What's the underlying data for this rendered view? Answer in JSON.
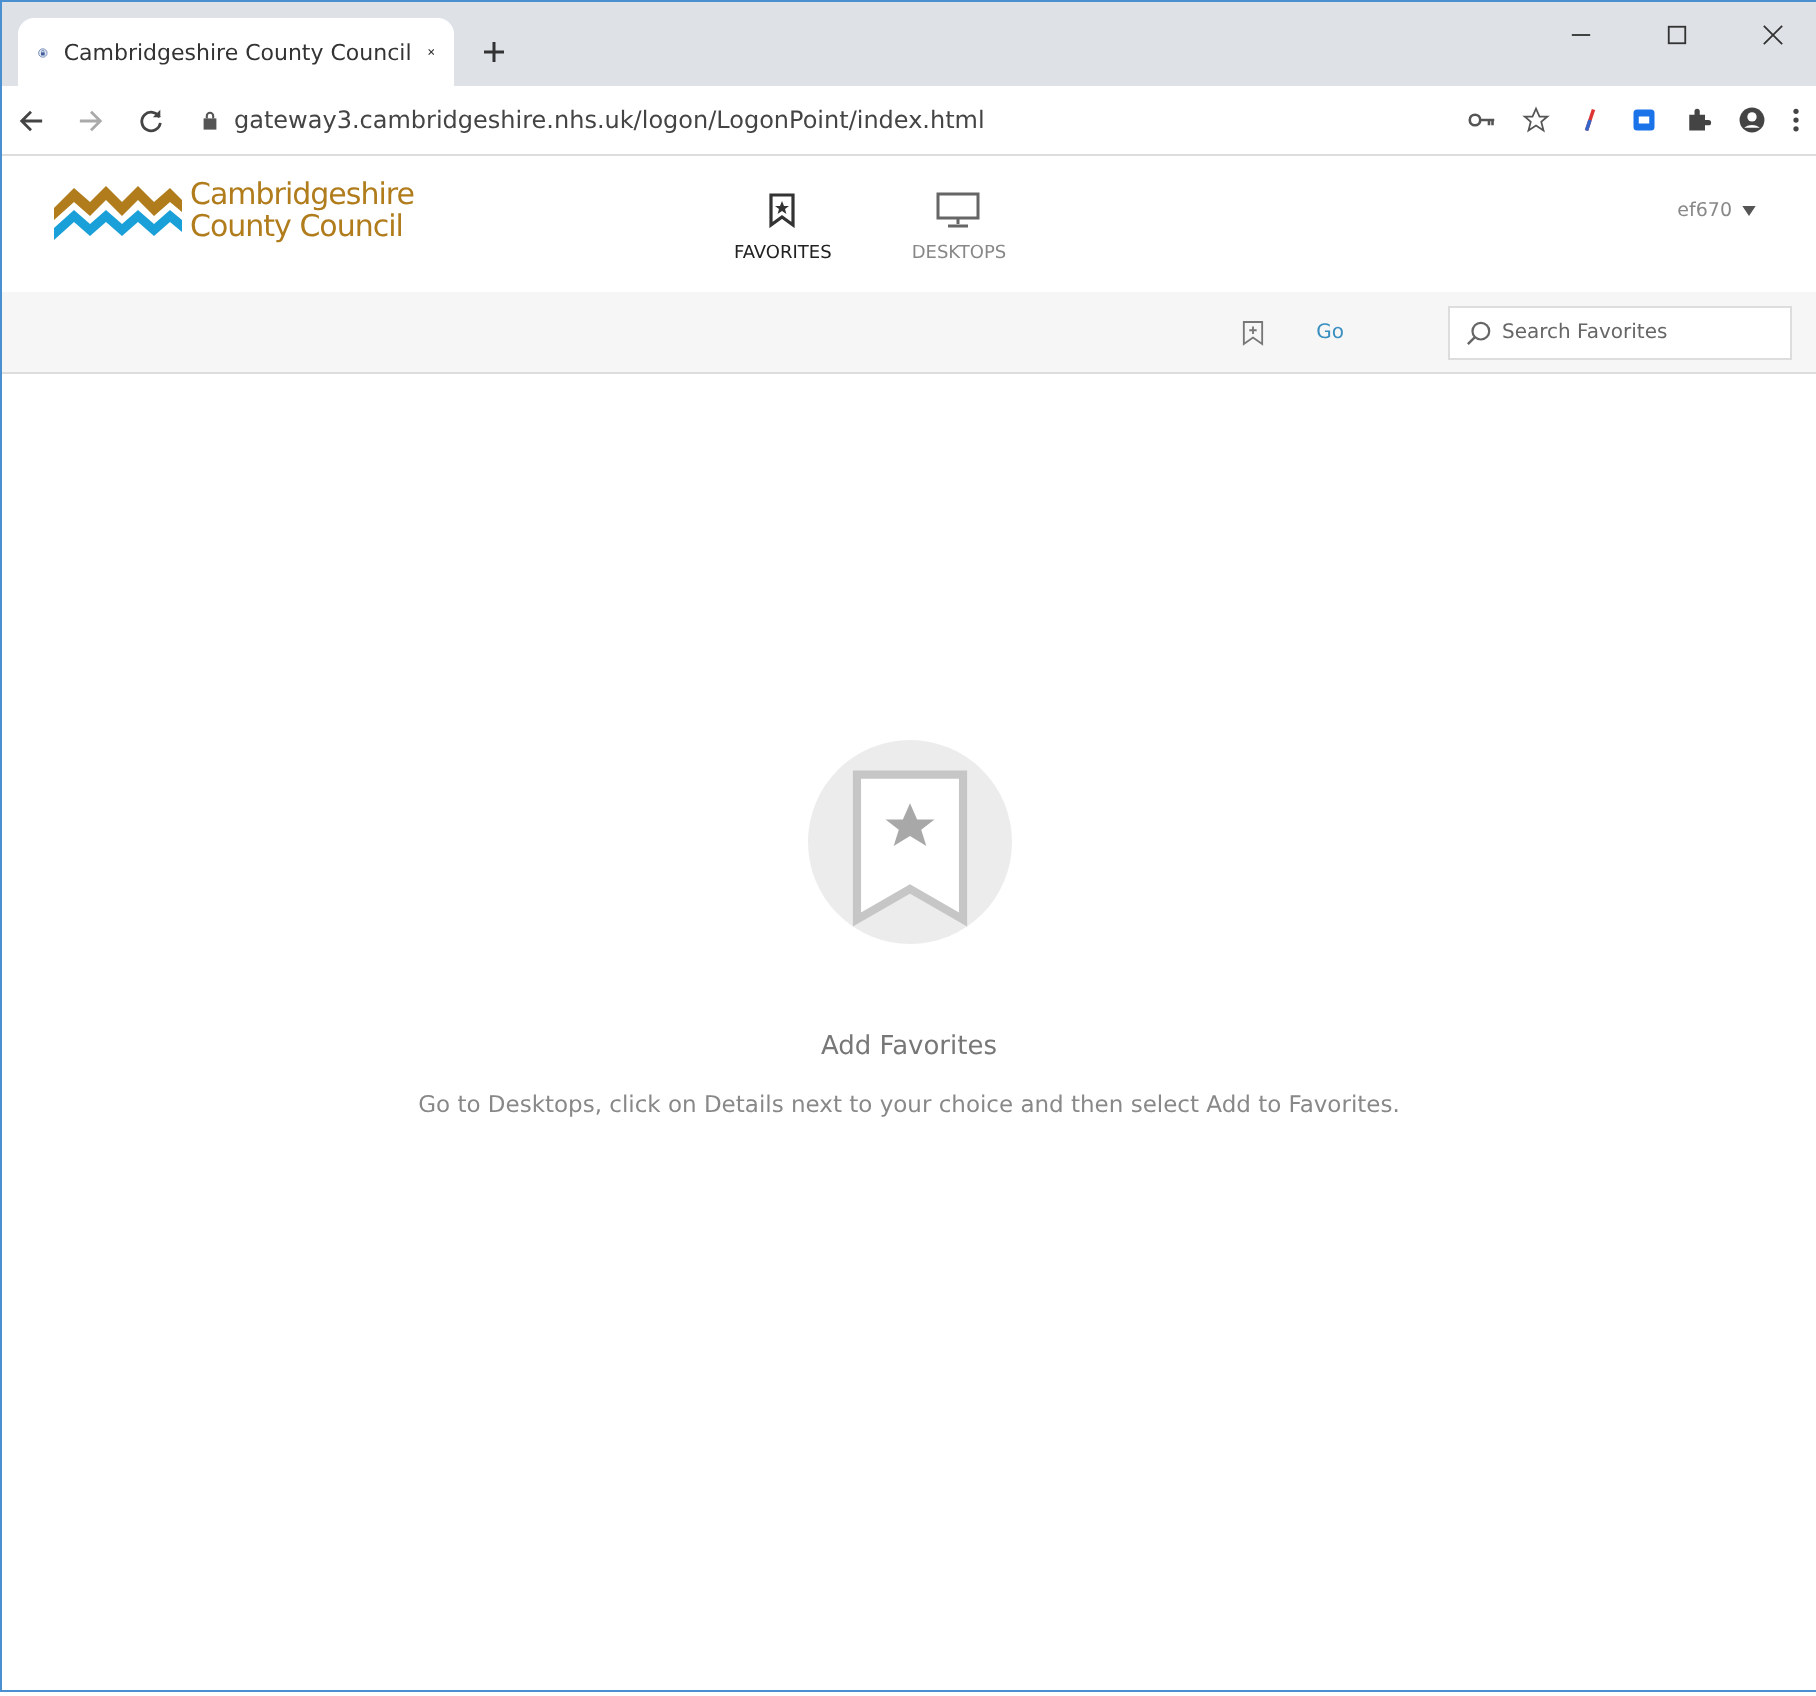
{
  "browser": {
    "tab_title": "Cambridgeshire County Council",
    "url": "gateway3.cambridgeshire.nhs.uk/logon/LogonPoint/index.html"
  },
  "header": {
    "logo_lines": [
      "Cambridgeshire",
      "County Council"
    ],
    "nav": [
      {
        "label": "FAVORITES",
        "kind": "favorites",
        "selected": true
      },
      {
        "label": "DESKTOPS",
        "kind": "desktops",
        "selected": false
      }
    ],
    "user": "ef670"
  },
  "toolbar": {
    "go": "Go",
    "search": {
      "placeholder": "Search Favorites"
    }
  },
  "empty_state": {
    "title": "Add Favorites",
    "message": "Go to Desktops, click on Details next to your choice and then select Add to Favorites."
  }
}
